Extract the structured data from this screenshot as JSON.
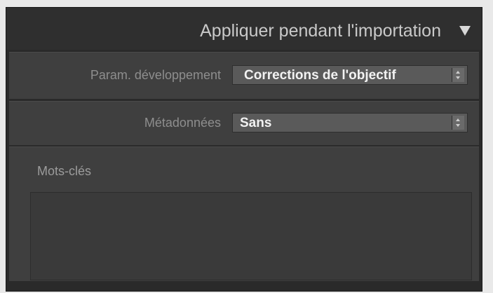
{
  "panel": {
    "title": "Appliquer pendant l'importation",
    "collapse_icon": "triangle-down-icon"
  },
  "develop_settings": {
    "label": "Param. développement",
    "value": "Corrections de l'objectif",
    "icon": "stepper-icon"
  },
  "metadata": {
    "label": "Métadonnées",
    "value": "Sans",
    "icon": "stepper-icon"
  },
  "keywords": {
    "label": "Mots-clés",
    "value": ""
  }
}
